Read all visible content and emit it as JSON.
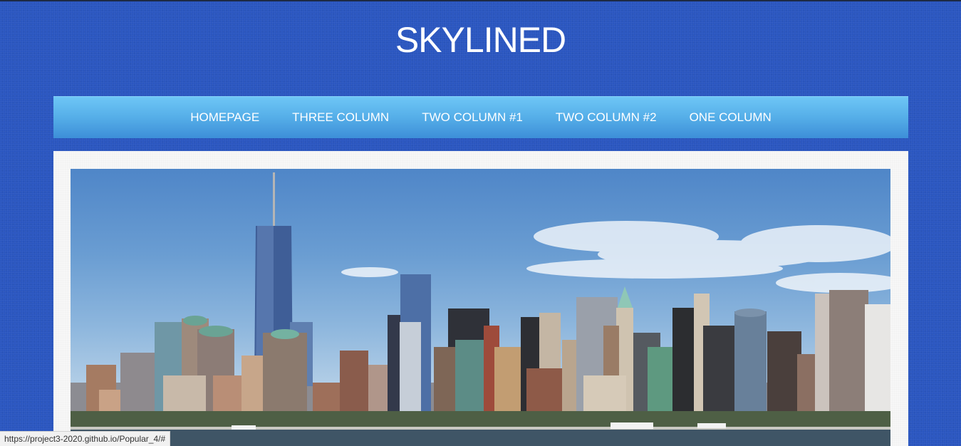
{
  "site": {
    "title": "SKYLINED"
  },
  "nav": {
    "items": [
      {
        "label": "HOMEPAGE"
      },
      {
        "label": "THREE COLUMN"
      },
      {
        "label": "TWO COLUMN #1"
      },
      {
        "label": "TWO COLUMN #2"
      },
      {
        "label": "ONE COLUMN"
      }
    ]
  },
  "hero": {
    "image": "city-skyline-photo"
  },
  "status_bar": {
    "url": "https://project3-2020.github.io/Popular_4/#"
  },
  "colors": {
    "background": "#2a56c0",
    "nav_gradient_top": "#6ec6f6",
    "nav_gradient_bottom": "#3d8ed8",
    "content_bg": "#f7f7f7",
    "title_text": "#ffffff"
  }
}
